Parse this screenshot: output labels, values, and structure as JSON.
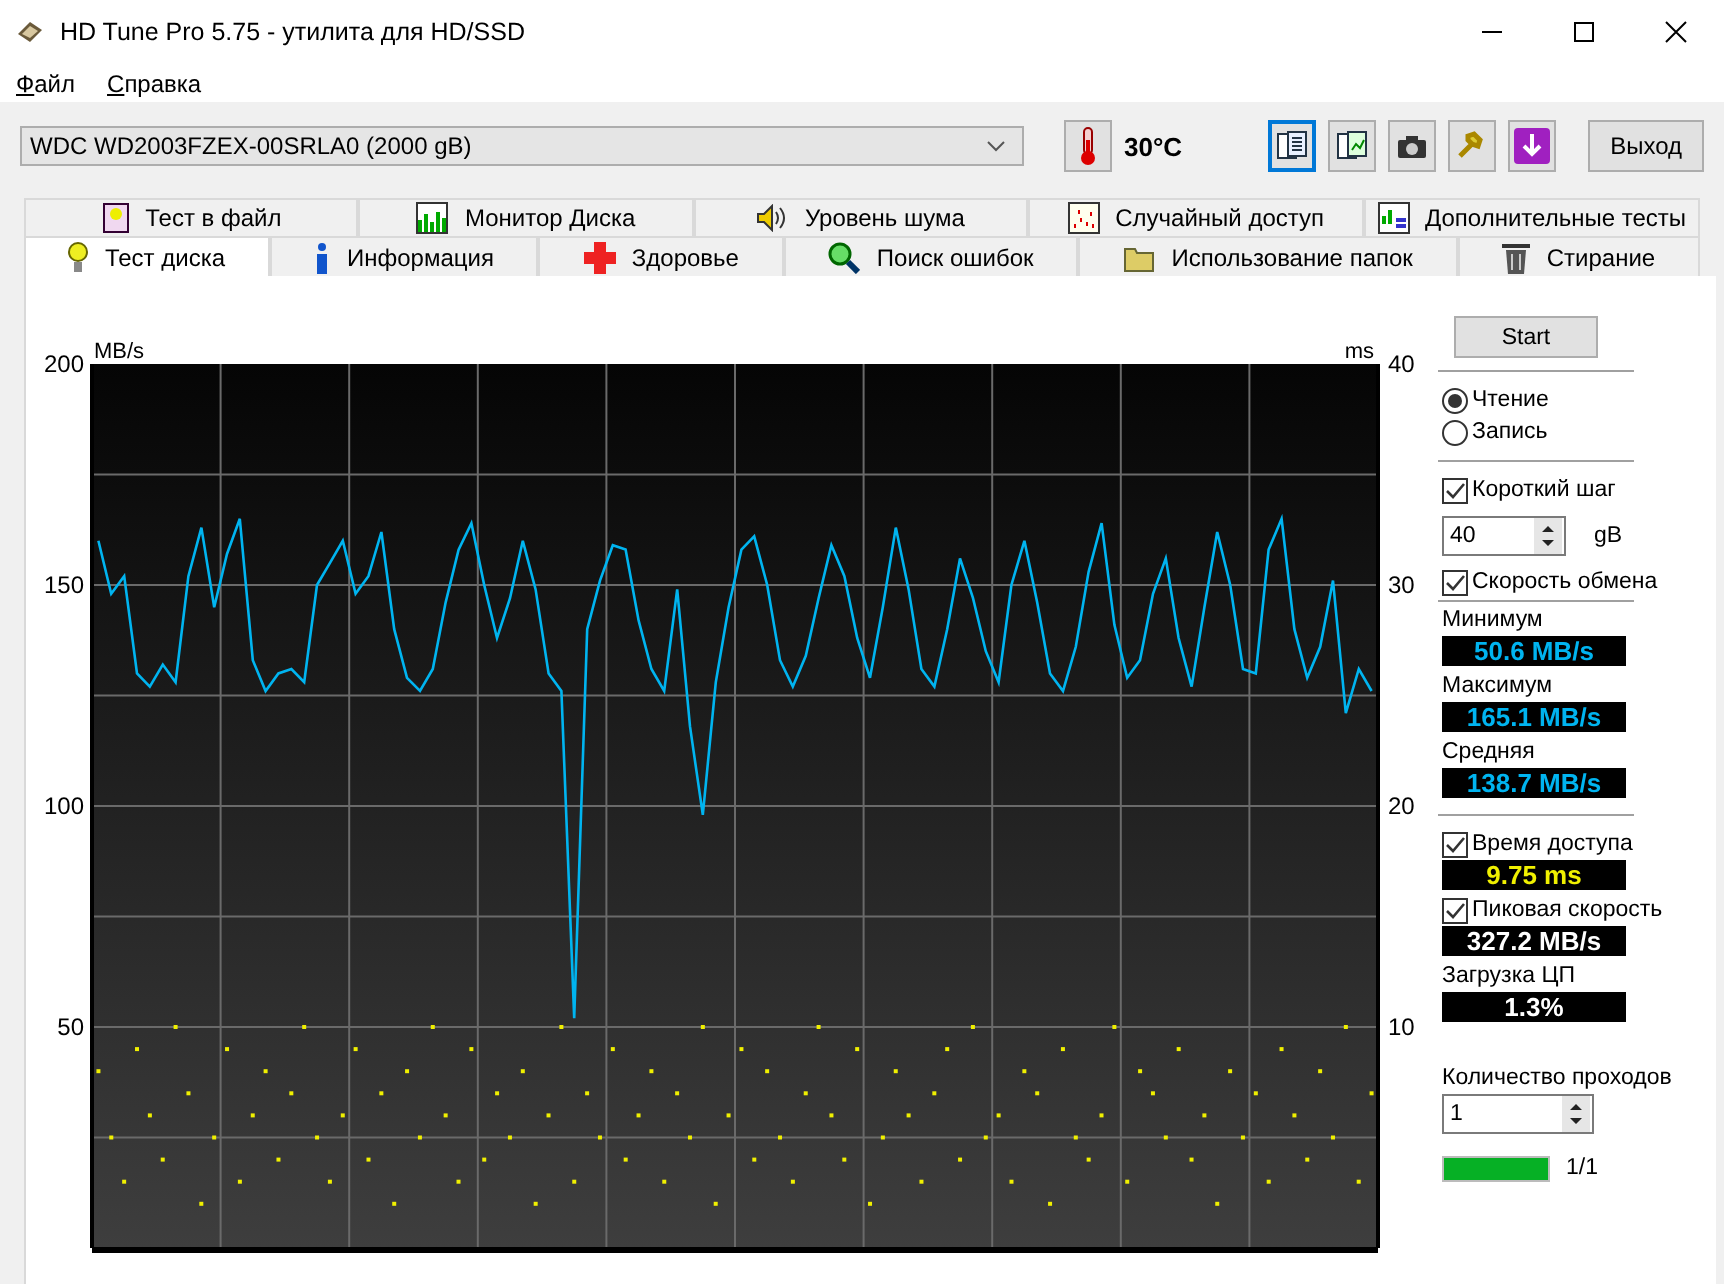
{
  "window": {
    "title": "HD Tune Pro 5.75 - утилита для HD/SSD"
  },
  "menu": [
    "Файл",
    "Справка"
  ],
  "toolbar": {
    "drive": "WDC WD2003FZEX-00SRLA0 (2000 gB)",
    "temperature": "30°C",
    "exit_button": "Выход"
  },
  "tabs_top": [
    {
      "label": "Тест в файл",
      "selected": false
    },
    {
      "label": "Монитор Диска",
      "selected": false
    },
    {
      "label": "Уровень шума",
      "selected": false
    },
    {
      "label": "Случайный доступ",
      "selected": false
    },
    {
      "label": "Дополнительные  тесты",
      "selected": false
    }
  ],
  "tabs_bottom": [
    {
      "label": "Тест диска",
      "selected": true
    },
    {
      "label": "Информация",
      "selected": false
    },
    {
      "label": "Здоровье",
      "selected": false
    },
    {
      "label": "Поиск ошибок",
      "selected": false
    },
    {
      "label": "Использование папок",
      "selected": false
    },
    {
      "label": "Стирание",
      "selected": false
    }
  ],
  "chart": {
    "chart_data": {
      "type": "line",
      "grid": true,
      "ylabel": "MB/s",
      "y2label": "ms",
      "ylim": [
        0,
        200
      ],
      "y2lim": [
        0,
        40
      ],
      "yticks": [
        50,
        100,
        150,
        200
      ],
      "y2ticks": [
        10,
        20,
        30,
        40
      ],
      "series": [
        {
          "color": "#00b4f0",
          "values": [
            160,
            148,
            152,
            130,
            127,
            132,
            128,
            152,
            163,
            145,
            157,
            165,
            133,
            126,
            130,
            131,
            128,
            150,
            155,
            160,
            148,
            152,
            162,
            140,
            129,
            126,
            131,
            146,
            158,
            164,
            150,
            138,
            147,
            160,
            149,
            130,
            126,
            52,
            140,
            151,
            159,
            158,
            142,
            131,
            126,
            149,
            118,
            98,
            128,
            145,
            158,
            161,
            150,
            133,
            127,
            134,
            147,
            159,
            152,
            138,
            129,
            145,
            163,
            149,
            131,
            127,
            140,
            156,
            147,
            135,
            128,
            150,
            160,
            146,
            130,
            126,
            136,
            153,
            164,
            141,
            129,
            133,
            148,
            156,
            138,
            127,
            145,
            162,
            150,
            131,
            130,
            158,
            165,
            140,
            129,
            136,
            151,
            121,
            131,
            126
          ]
        },
        {
          "color": "#f0f000",
          "type": "scatter",
          "axis": "y2",
          "values": [
            8,
            5,
            3,
            9,
            6,
            4,
            10,
            7,
            2,
            5,
            9,
            3,
            6,
            8,
            4,
            7,
            10,
            5,
            3,
            6,
            9,
            4,
            7,
            2,
            8,
            5,
            10,
            6,
            3,
            9,
            4,
            7,
            5,
            8,
            2,
            6,
            10,
            3,
            7,
            5,
            9,
            4,
            6,
            8,
            3,
            7,
            5,
            10,
            2,
            6,
            9,
            4,
            8,
            5,
            3,
            7,
            10,
            6,
            4,
            9,
            2,
            5,
            8,
            6,
            3,
            7,
            9,
            4,
            10,
            5,
            6,
            3,
            8,
            7,
            2,
            9,
            5,
            4,
            6,
            10,
            3,
            8,
            7,
            5,
            9,
            4,
            6,
            2,
            8,
            5,
            7,
            3,
            9,
            6,
            4,
            8,
            5,
            10,
            3,
            7
          ]
        }
      ]
    }
  },
  "controls": {
    "start_button": "Start",
    "mode": [
      {
        "label": "Чтение",
        "selected": true
      },
      {
        "label": "Запись",
        "selected": false
      }
    ],
    "short_stroke": {
      "label": "Короткий шаг",
      "checked": true,
      "value": "40",
      "unit": "gB"
    },
    "transfer_rate": {
      "label": "Скорость обмена",
      "checked": true
    },
    "transfer_readouts": [
      {
        "label": "Минимум",
        "value": "50.6 MB/s"
      },
      {
        "label": "Максимум",
        "value": "165.1 MB/s"
      },
      {
        "label": "Средняя",
        "value": "138.7 MB/s"
      }
    ],
    "access_time": {
      "label": "Время доступа",
      "checked": true,
      "value": "9.75 ms"
    },
    "burst_rate": {
      "label": "Пиковая скорость",
      "checked": true,
      "value": "327.2 MB/s"
    },
    "cpu_usage": {
      "label": "Загрузка ЦП",
      "value": "1.3%"
    },
    "passes": {
      "label": "Количество проходов",
      "value": "1"
    },
    "progress": {
      "level": 1,
      "text": "1/1"
    }
  }
}
